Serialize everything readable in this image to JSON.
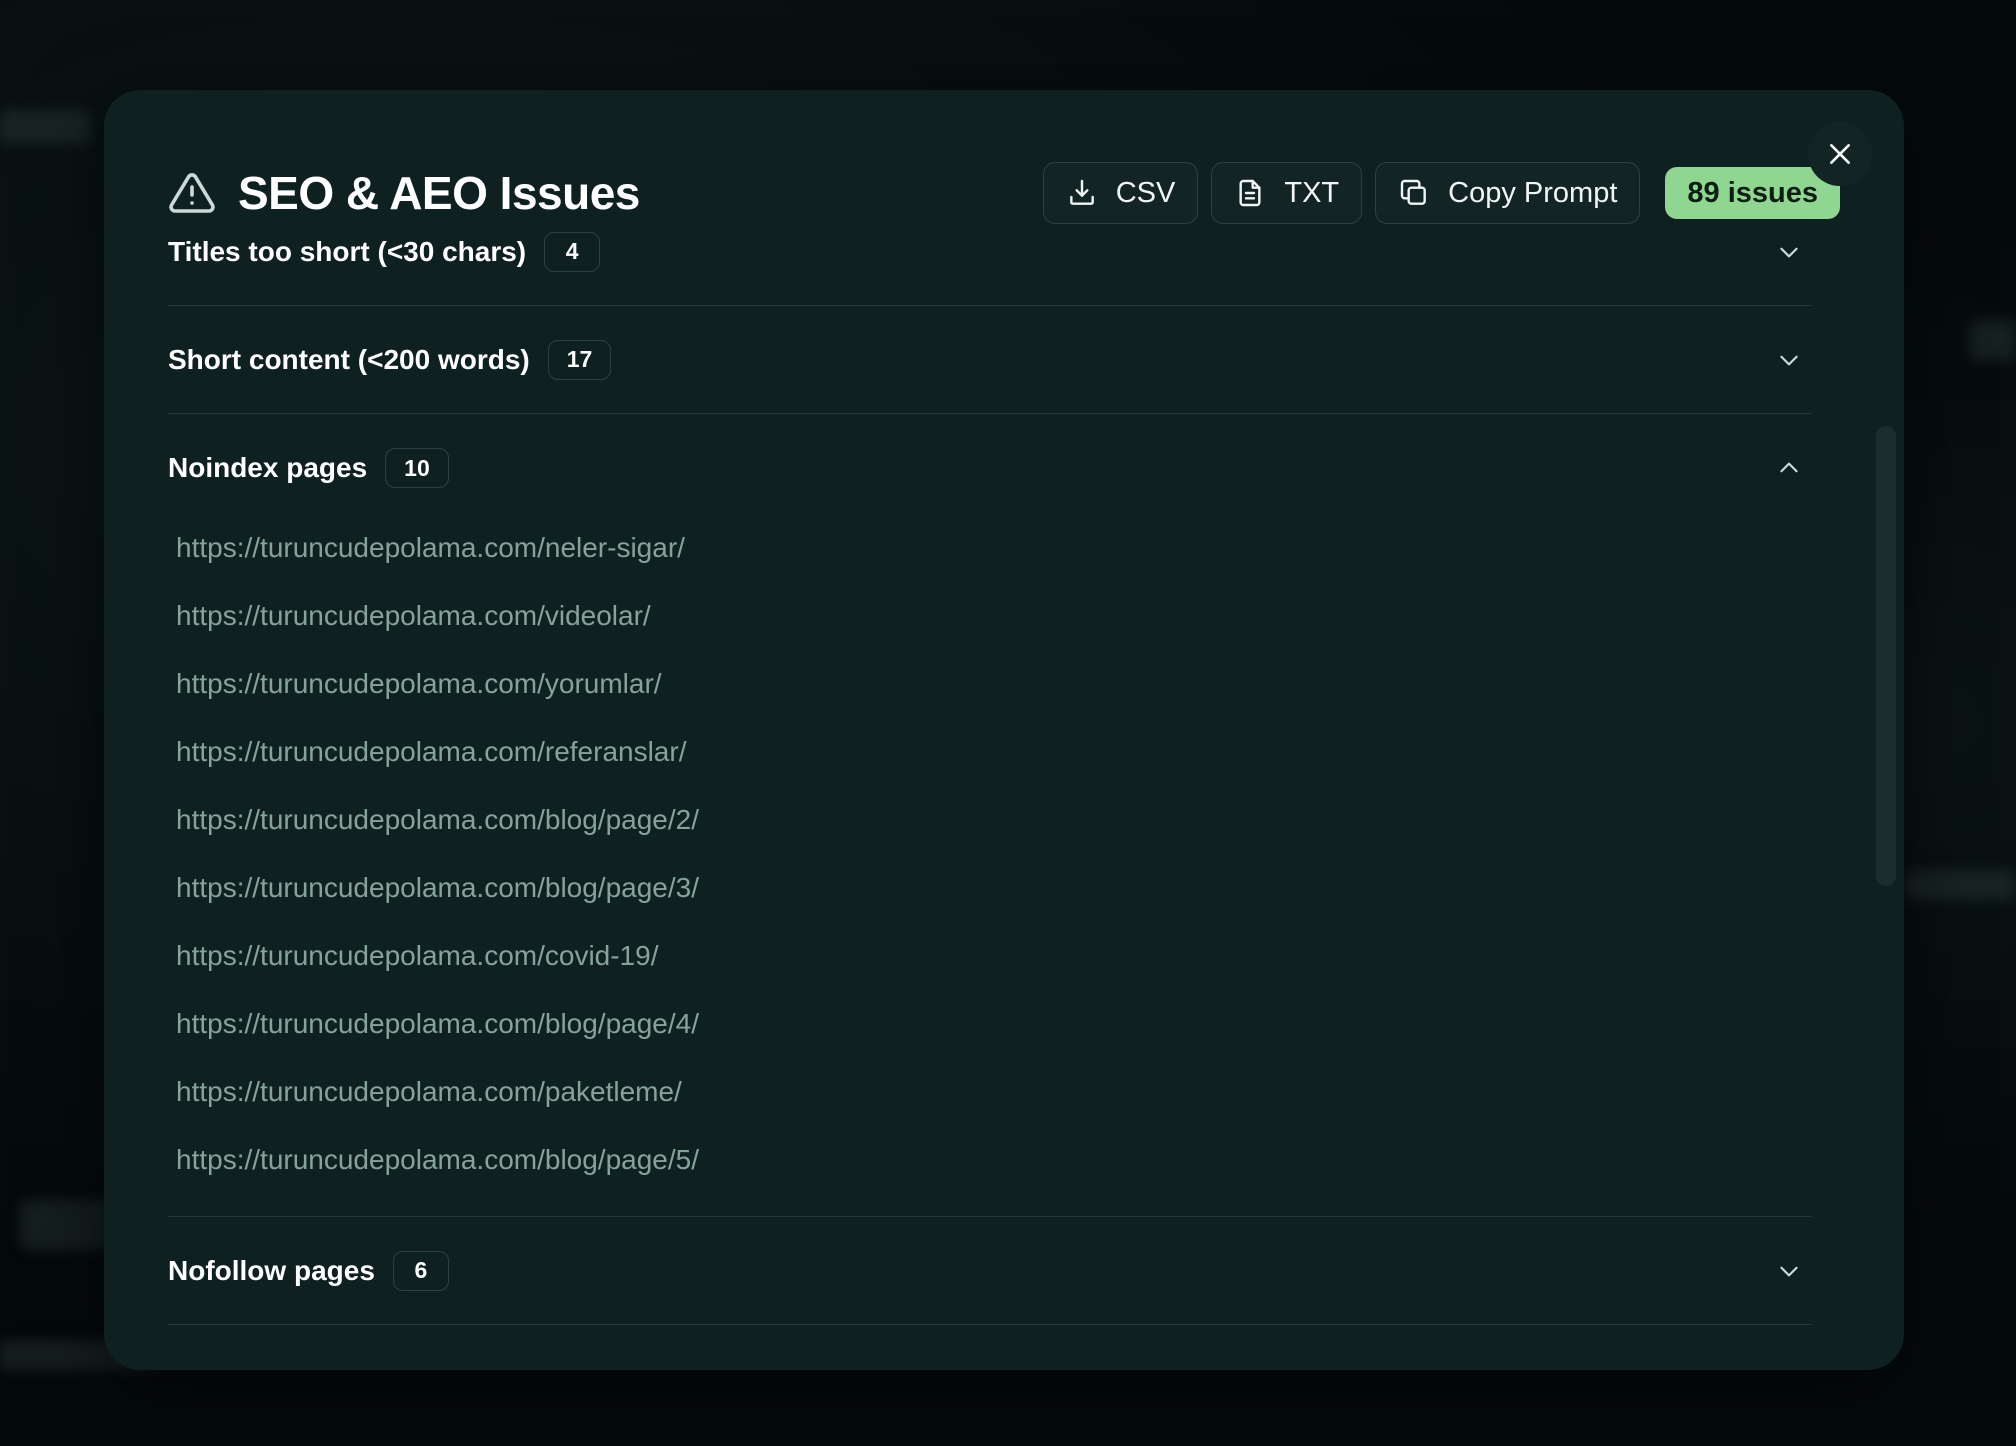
{
  "header": {
    "title": "SEO & AEO Issues",
    "csv_label": "CSV",
    "txt_label": "TXT",
    "copy_label": "Copy Prompt",
    "issues_badge": "89 issues"
  },
  "sections": [
    {
      "label": "Titles too short (<30 chars)",
      "count": "4",
      "expanded": false
    },
    {
      "label": "Short content (<200 words)",
      "count": "17",
      "expanded": false
    },
    {
      "label": "Noindex pages",
      "count": "10",
      "expanded": true,
      "urls": [
        "https://turuncudepolama.com/neler-sigar/",
        "https://turuncudepolama.com/videolar/",
        "https://turuncudepolama.com/yorumlar/",
        "https://turuncudepolama.com/referanslar/",
        "https://turuncudepolama.com/blog/page/2/",
        "https://turuncudepolama.com/blog/page/3/",
        "https://turuncudepolama.com/covid-19/",
        "https://turuncudepolama.com/blog/page/4/",
        "https://turuncudepolama.com/paketleme/",
        "https://turuncudepolama.com/blog/page/5/"
      ]
    },
    {
      "label": "Nofollow pages",
      "count": "6",
      "expanded": false
    }
  ],
  "colors": {
    "modal_bg": "#0f2020",
    "badge_bg": "#8fd691",
    "url_text": "#86a39b"
  }
}
